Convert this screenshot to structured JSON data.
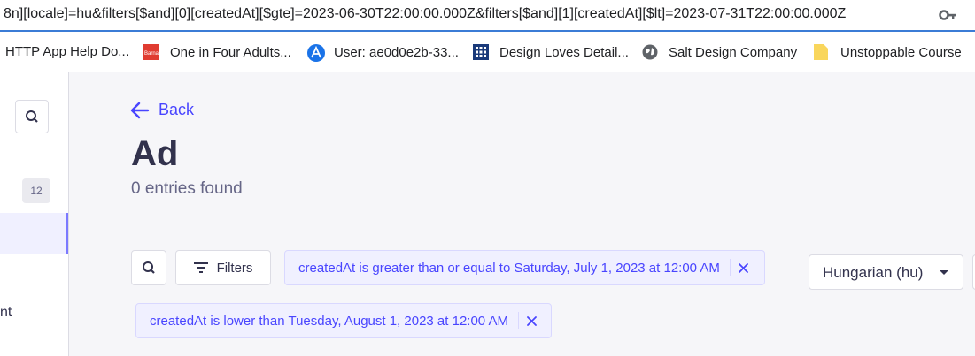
{
  "browser": {
    "url": "8n][locale]=hu&filters[$and][0][createdAt][$gte]=2023-06-30T22:00:00.000Z&filters[$and][1][createdAt][$lt]=2023-07-31T22:00:00.000Z",
    "key_icon": "key-icon"
  },
  "bookmarks": [
    {
      "label": "HTTP App Help Do...",
      "icon": "none"
    },
    {
      "label": "One in Four Adults...",
      "icon": "barna-icon",
      "icon_text": "Barna",
      "color": "#e03c31"
    },
    {
      "label": "User: ae0d0e2b-33...",
      "icon": "user-a-icon",
      "color": "#1a73e8"
    },
    {
      "label": "Design Loves Detail...",
      "icon": "grid-icon",
      "color": "#1a3a7a"
    },
    {
      "label": "Salt Design Company",
      "icon": "globe-icon",
      "color": "#5f6368"
    },
    {
      "label": "Unstoppable Course",
      "icon": "note-icon",
      "color": "#f9d65c"
    }
  ],
  "sidebar": {
    "count_badge": "12",
    "partial_label": "nt"
  },
  "header": {
    "back_label": "Back",
    "title": "Ad",
    "subtitle": "0 entries found"
  },
  "toolbar": {
    "filters_label": "Filters",
    "filters": [
      {
        "label": "createdAt is greater than or equal to Saturday, July 1, 2023 at 12:00 AM"
      },
      {
        "label": "createdAt is lower than Tuesday, August 1, 2023 at 12:00 AM"
      }
    ],
    "locale_select": "Hungarian (hu)"
  },
  "colors": {
    "primary": "#4945ff",
    "text": "#32324d",
    "muted": "#666687"
  }
}
